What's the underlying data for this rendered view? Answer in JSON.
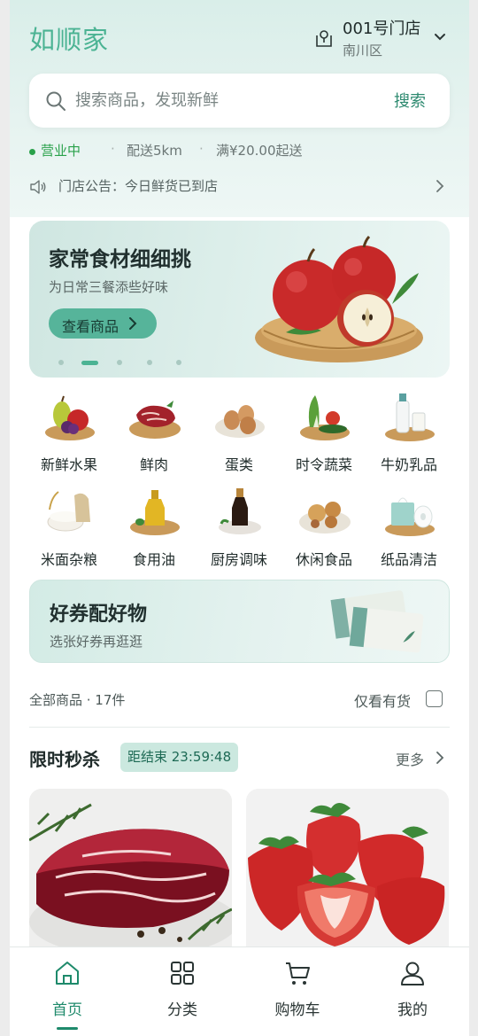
{
  "brand": "如顺家",
  "store": {
    "name": "001号门店",
    "area": "南川区"
  },
  "search": {
    "placeholder": "搜索商品，发现新鲜",
    "button": "搜索"
  },
  "status": {
    "open": "营业中",
    "delivery": "配送5km",
    "minimum": "满¥20.00起送",
    "separator": "·"
  },
  "notice": {
    "text": "门店公告：今日鲜货已到店"
  },
  "banner": {
    "title": "家常食材细细挑",
    "subtitle": "为日常三餐添些好味",
    "button": "查看商品",
    "slide_count": 5,
    "active_slide": 2
  },
  "categories": [
    {
      "label": "新鲜水果",
      "icon": "fruit-icon"
    },
    {
      "label": "鲜肉",
      "icon": "meat-icon"
    },
    {
      "label": "蛋类",
      "icon": "egg-icon"
    },
    {
      "label": "时令蔬菜",
      "icon": "vegetable-icon"
    },
    {
      "label": "牛奶乳品",
      "icon": "milk-icon"
    },
    {
      "label": "米面杂粮",
      "icon": "rice-icon"
    },
    {
      "label": "食用油",
      "icon": "oil-icon"
    },
    {
      "label": "厨房调味",
      "icon": "sauce-icon"
    },
    {
      "label": "休闲食品",
      "icon": "snack-icon"
    },
    {
      "label": "纸品清洁",
      "icon": "tissue-icon"
    }
  ],
  "coupon": {
    "title": "好券配好物",
    "subtitle": "选张好券再逛逛"
  },
  "filter": {
    "count": "全部商品 · 17件",
    "in_stock": "仅看有货"
  },
  "flash_sale": {
    "title": "限时秒杀",
    "timer": "距结束 23:59:48",
    "more": "更多"
  },
  "products": [
    {
      "image": "steak"
    },
    {
      "image": "strawberries"
    }
  ],
  "tabs": [
    {
      "label": "首页",
      "icon": "home-icon",
      "active": true
    },
    {
      "label": "分类",
      "icon": "grid-icon",
      "active": false
    },
    {
      "label": "购物车",
      "icon": "cart-icon",
      "active": false
    },
    {
      "label": "我的",
      "icon": "user-icon",
      "active": false
    }
  ],
  "colors": {
    "accent": "#4bb393",
    "primary_dark": "#1e8a6b",
    "open_green": "#29a14a"
  }
}
